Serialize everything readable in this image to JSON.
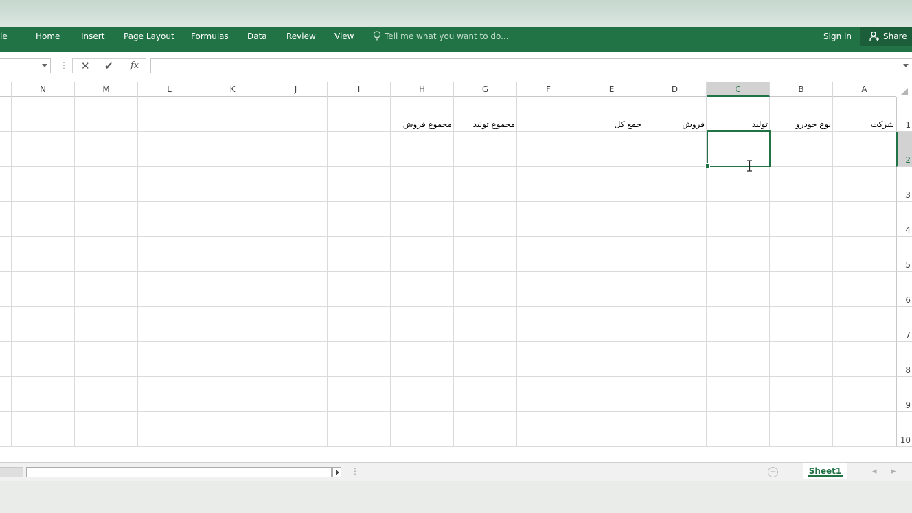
{
  "ribbon": {
    "file_tab": "le",
    "tabs": [
      "Home",
      "Insert",
      "Page Layout",
      "Formulas",
      "Data",
      "Review",
      "View"
    ],
    "tell_me": "Tell me what you want to do...",
    "sign_in": "Sign in",
    "share": "Share"
  },
  "formula_bar": {
    "namebox_value": "",
    "formula_value": "",
    "fx_label": "fx"
  },
  "columns": [
    "N",
    "M",
    "L",
    "K",
    "J",
    "I",
    "H",
    "G",
    "F",
    "E",
    "D",
    "C",
    "B",
    "A"
  ],
  "rows": [
    "1",
    "2",
    "3",
    "4",
    "5",
    "6",
    "7",
    "8",
    "9",
    "10"
  ],
  "selected": {
    "column": "C",
    "row": "2"
  },
  "cells": {
    "A1": "شرکت",
    "B1": "نوع خودرو",
    "C1": "تولید",
    "D1": "فروش",
    "E1": "جمع کل",
    "G1": "مجموع تولید",
    "H1": "مجموع فروش"
  },
  "sheets": {
    "active": "Sheet1"
  },
  "colors": {
    "accent": "#217346"
  }
}
